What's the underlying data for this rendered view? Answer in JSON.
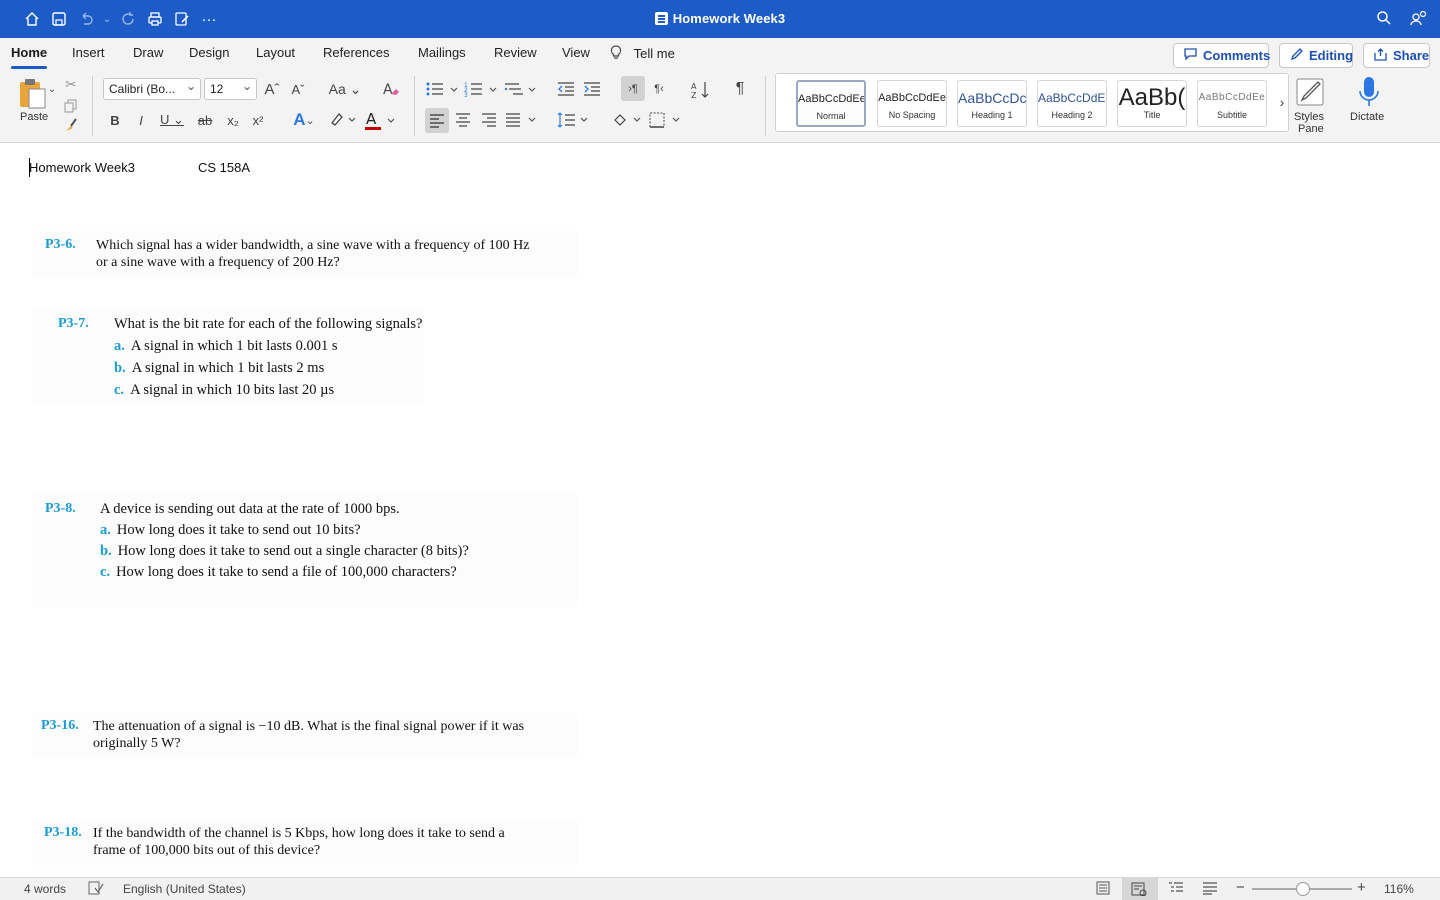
{
  "window": {
    "title": "Homework Week3"
  },
  "quick_access": {
    "icons": [
      "home-icon",
      "save-icon",
      "undo-icon",
      "redo-icon",
      "print-icon",
      "edit-icon",
      "more-icon"
    ],
    "more_label": "···"
  },
  "ribbon_tabs": [
    "Home",
    "Insert",
    "Draw",
    "Design",
    "Layout",
    "References",
    "Mailings",
    "Review",
    "View"
  ],
  "tell_me": "Tell me",
  "header_buttons": {
    "comments": "Comments",
    "editing": "Editing",
    "share": "Share"
  },
  "ribbon": {
    "paste_label": "Paste",
    "font_name": "Calibri (Bo...",
    "font_size": "12",
    "styles": [
      {
        "sample": "AaBbCcDdEe",
        "name": "Normal"
      },
      {
        "sample": "AaBbCcDdEe",
        "name": "No Spacing"
      },
      {
        "sample": "AaBbCcDc",
        "name": "Heading 1"
      },
      {
        "sample": "AaBbCcDdEe",
        "name": "Heading 2"
      },
      {
        "sample": "AaBb(",
        "name": "Title"
      },
      {
        "sample": "AaBbCcDdEe",
        "name": "Subtitle"
      }
    ],
    "styles_pane_label_1": "Styles",
    "styles_pane_label_2": "Pane",
    "dictate_label": "Dictate"
  },
  "document": {
    "header_left": "Homework Week3",
    "header_right": "CS 158A",
    "questions": [
      {
        "num": "P3-6.",
        "lines": [
          "Which signal has a wider bandwidth, a sine wave with a frequency of 100 Hz",
          "or a sine wave with a frequency of 200 Hz?"
        ],
        "items": []
      },
      {
        "num": "P3-7.",
        "lines": [
          "What is the bit rate for each of the following signals?"
        ],
        "items": [
          {
            "letter": "a.",
            "text": "A signal in which 1 bit lasts 0.001 s"
          },
          {
            "letter": "b.",
            "text": "A signal in which 1 bit lasts 2 ms"
          },
          {
            "letter": "c.",
            "text": "A signal in which 10 bits last 20 µs"
          }
        ]
      },
      {
        "num": "P3-8.",
        "lines": [
          "A device is sending out data at the rate of 1000 bps."
        ],
        "items": [
          {
            "letter": "a.",
            "text": "How long does it take to send out 10 bits?"
          },
          {
            "letter": "b.",
            "text": "How long does it take to send out a single character (8 bits)?"
          },
          {
            "letter": "c.",
            "text": "How long does it take to send a file of 100,000 characters?"
          }
        ]
      },
      {
        "num": "P3-16.",
        "lines": [
          "The attenuation of a signal is −10 dB. What is the final signal power if it was",
          "originally 5 W?"
        ],
        "items": []
      },
      {
        "num": "P3-18.",
        "lines": [
          "If the bandwidth of the channel is 5 Kbps, how long does it take to send a",
          "frame of 100,000 bits out of this device?"
        ],
        "items": []
      }
    ]
  },
  "status_bar": {
    "word_count": "4 words",
    "language": "English (United States)",
    "zoom": "116%",
    "zoom_level_percent": 116
  },
  "colors": {
    "titlebar": "#1d5bc7",
    "question_number": "#1c9bd4"
  }
}
